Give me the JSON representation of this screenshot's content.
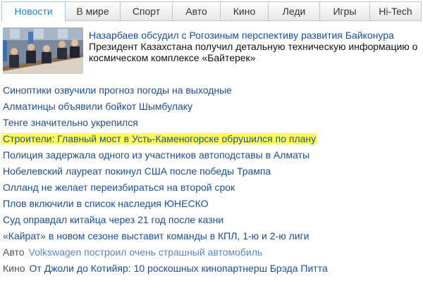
{
  "tabs": [
    {
      "label": "Новости",
      "active": true
    },
    {
      "label": "В мире",
      "active": false
    },
    {
      "label": "Спорт",
      "active": false
    },
    {
      "label": "Авто",
      "active": false
    },
    {
      "label": "Кино",
      "active": false
    },
    {
      "label": "Леди",
      "active": false
    },
    {
      "label": "Игры",
      "active": false
    },
    {
      "label": "Hi-Tech",
      "active": false
    }
  ],
  "featured": {
    "title": "Назарбаев обсудил с Рогозиным перспективу развития Байконура",
    "text": "Президент Казахстана получил детальную техническую информацию о космическом комплексе «Байтерек»"
  },
  "news": [
    {
      "text": "Синоптики озвучили прогноз погоды на выходные"
    },
    {
      "text": "Алматинцы объявили бойкот Шымбулаку"
    },
    {
      "text": "Тенге значительно укрепился"
    },
    {
      "text": "Строители: Главный мост в Усть-Каменогорске обрушился по плану",
      "highlighted": true
    },
    {
      "text": "Полиция задержала одного из участников автоподставы в Алматы"
    },
    {
      "text": "Нобелевский лауреат покинул США после победы Трампа"
    },
    {
      "text": "Олланд не желает переизбираться на второй срок"
    },
    {
      "text": "Плов включили в список наследия ЮНЕСКО"
    },
    {
      "text": "Суд оправдал китайца через 21 год после казни"
    },
    {
      "text": "«Кайрат» в новом сезоне выставит команды в КПЛ, 1-ю и 2-ю лиги"
    },
    {
      "category": "Авто",
      "text": "Volkswagen построил очень страшный автомобиль",
      "dim": true
    },
    {
      "category": "Кино",
      "text": "От Джоли до Котийяр: 10 роскошных кинопартнерш Брэда Питта"
    }
  ],
  "colors": {
    "link": "#1a4e94",
    "active_tab": "#2b7ec6",
    "highlight": "#ffff55"
  }
}
